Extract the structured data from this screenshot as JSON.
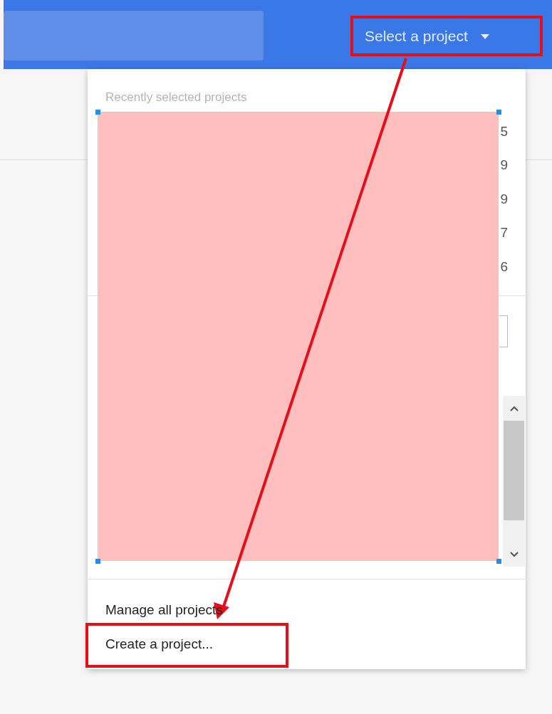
{
  "top_bar": {
    "project_picker": {
      "label": "Select a project",
      "highlighted": true
    }
  },
  "dropdown": {
    "section_title": "Recently selected projects",
    "redacted": true,
    "project_rows": [
      {
        "visible_text": "5"
      },
      {
        "visible_text": "9"
      },
      {
        "visible_text": "9"
      },
      {
        "visible_text": "7"
      },
      {
        "visible_text": "6"
      }
    ],
    "actions": [
      {
        "label": "Manage all projects",
        "highlighted": false
      },
      {
        "label": "Create a project...",
        "highlighted": true
      }
    ]
  },
  "annotation_arrow": true
}
